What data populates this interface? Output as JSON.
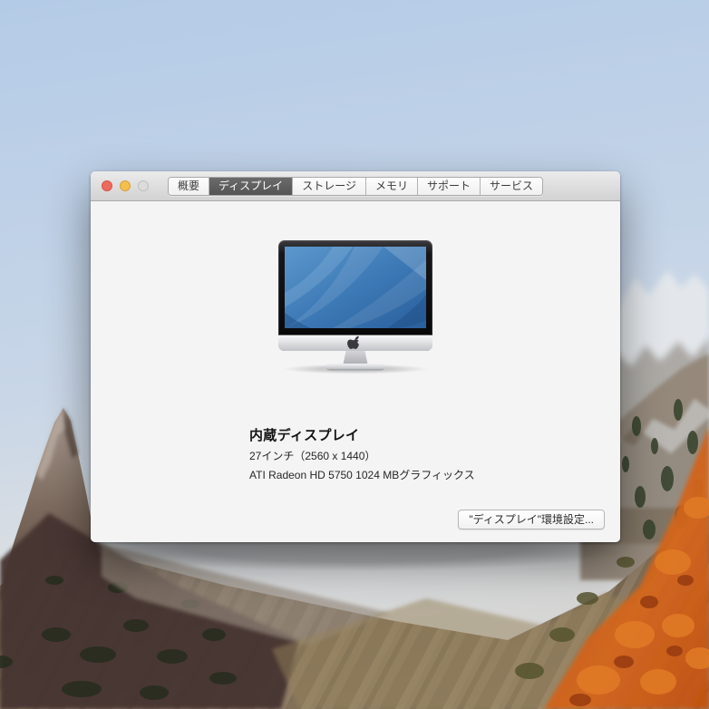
{
  "window": {
    "title_bar": {
      "traffic_lights": {
        "close_color": "#ed6a5e",
        "minimize_color": "#f5bf4f",
        "zoom_color": "#dcdcdc"
      },
      "tabs": [
        {
          "label": "概要",
          "selected": false
        },
        {
          "label": "ディスプレイ",
          "selected": true
        },
        {
          "label": "ストレージ",
          "selected": false
        },
        {
          "label": "メモリ",
          "selected": false
        },
        {
          "label": "サポート",
          "selected": false
        },
        {
          "label": "サービス",
          "selected": false
        }
      ],
      "selected_tab_color": "#5c5c5c"
    },
    "display_panel": {
      "heading": "内蔵ディスプレイ",
      "size": "27インチ（2560 x 1440）",
      "graphics": "ATI Radeon HD 5750 1024 MBグラフィックス",
      "preferences_button": "\"ディスプレイ\"環境設定...",
      "imac_icon": "imac-27-inch-illustration",
      "imac_screen_color": "#3f7cb6"
    }
  }
}
